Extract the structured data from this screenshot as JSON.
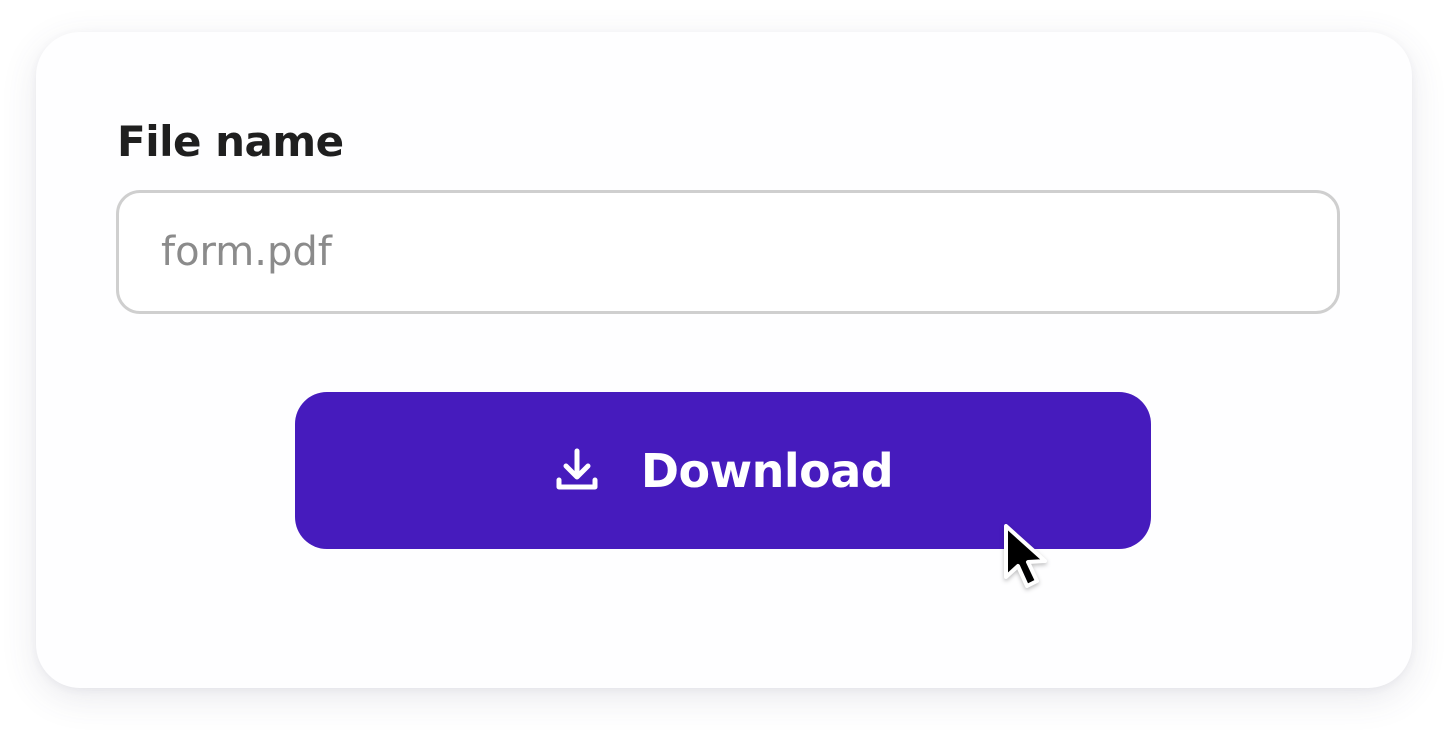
{
  "form": {
    "label": "File name",
    "input": {
      "value": "",
      "placeholder": "form.pdf"
    },
    "download_button": {
      "label": "Download",
      "icon": "download-icon"
    }
  },
  "cursor": {
    "icon": "mouse-pointer-icon"
  },
  "colors": {
    "accent": "#461bbd",
    "label_text": "#1f1f1f",
    "placeholder_text": "#8b8b8b",
    "input_border": "#cfcfcf",
    "card_background": "#fefeff"
  }
}
